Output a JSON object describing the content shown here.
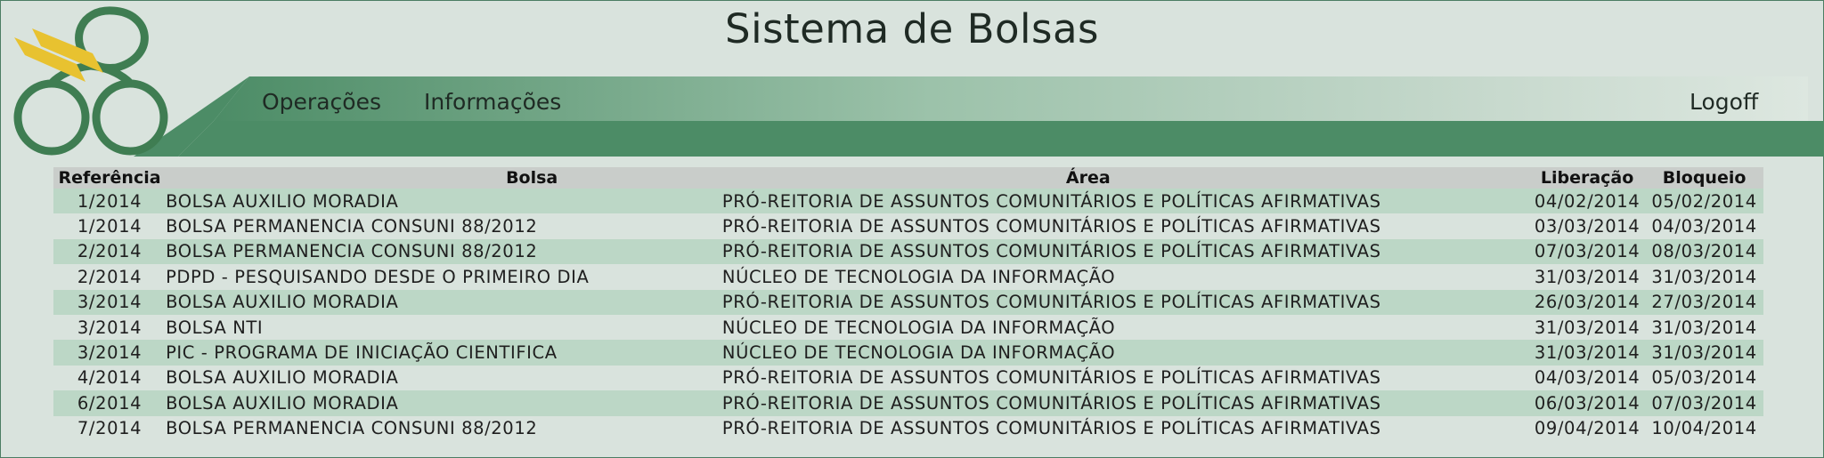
{
  "app": {
    "title": "Sistema de Bolsas"
  },
  "menu": {
    "items": [
      {
        "label": "Operações"
      },
      {
        "label": "Informações"
      }
    ],
    "logoff": "Logoff"
  },
  "colors": {
    "primary_green": "#4c8c66",
    "row_stripe": "#bcd7c6",
    "background": "#d9e3dd"
  },
  "table": {
    "headers": [
      "Referência",
      "Bolsa",
      "Área",
      "Liberação",
      "Bloqueio"
    ],
    "rows": [
      [
        "1/2014",
        "BOLSA AUXILIO MORADIA",
        "PRÓ-REITORIA DE ASSUNTOS COMUNITÁRIOS E POLÍTICAS AFIRMATIVAS",
        "04/02/2014",
        "05/02/2014"
      ],
      [
        "1/2014",
        "BOLSA PERMANENCIA CONSUNI 88/2012",
        "PRÓ-REITORIA DE ASSUNTOS COMUNITÁRIOS E POLÍTICAS AFIRMATIVAS",
        "03/03/2014",
        "04/03/2014"
      ],
      [
        "2/2014",
        "BOLSA PERMANENCIA CONSUNI 88/2012",
        "PRÓ-REITORIA DE ASSUNTOS COMUNITÁRIOS E POLÍTICAS AFIRMATIVAS",
        "07/03/2014",
        "08/03/2014"
      ],
      [
        "2/2014",
        "PDPD - PESQUISANDO DESDE O PRIMEIRO DIA",
        "NÚCLEO DE TECNOLOGIA DA INFORMAÇÃO",
        "31/03/2014",
        "31/03/2014"
      ],
      [
        "3/2014",
        "BOLSA AUXILIO MORADIA",
        "PRÓ-REITORIA DE ASSUNTOS COMUNITÁRIOS E POLÍTICAS AFIRMATIVAS",
        "26/03/2014",
        "27/03/2014"
      ],
      [
        "3/2014",
        "BOLSA NTI",
        "NÚCLEO DE TECNOLOGIA DA INFORMAÇÃO",
        "31/03/2014",
        "31/03/2014"
      ],
      [
        "3/2014",
        "PIC - PROGRAMA DE INICIAÇÃO CIENTIFICA",
        "NÚCLEO DE TECNOLOGIA DA INFORMAÇÃO",
        "31/03/2014",
        "31/03/2014"
      ],
      [
        "4/2014",
        "BOLSA AUXILIO MORADIA",
        "PRÓ-REITORIA DE ASSUNTOS COMUNITÁRIOS E POLÍTICAS AFIRMATIVAS",
        "04/03/2014",
        "05/03/2014"
      ],
      [
        "6/2014",
        "BOLSA AUXILIO MORADIA",
        "PRÓ-REITORIA DE ASSUNTOS COMUNITÁRIOS E POLÍTICAS AFIRMATIVAS",
        "06/03/2014",
        "07/03/2014"
      ],
      [
        "7/2014",
        "BOLSA PERMANENCIA CONSUNI 88/2012",
        "PRÓ-REITORIA DE ASSUNTOS COMUNITÁRIOS E POLÍTICAS AFIRMATIVAS",
        "09/04/2014",
        "10/04/2014"
      ]
    ]
  }
}
